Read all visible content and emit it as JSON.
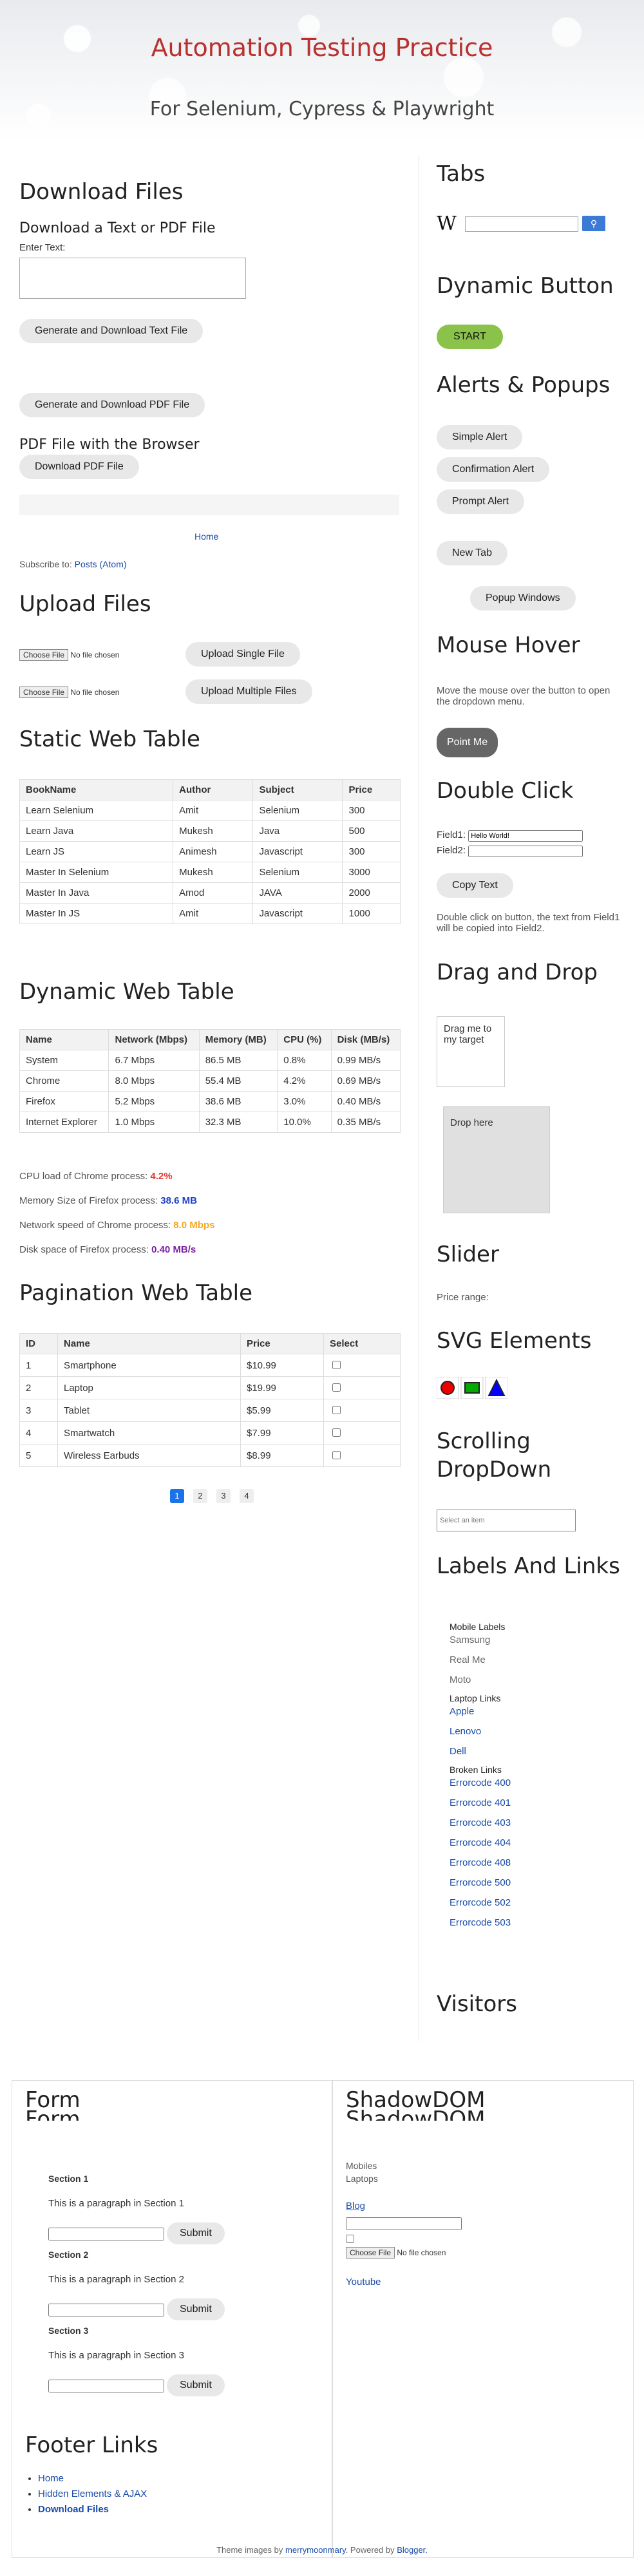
{
  "header": {
    "title": "Automation Testing Practice",
    "subtitle": "For Selenium, Cypress & Playwright"
  },
  "download": {
    "heading": "Download Files",
    "subheading": "Download a Text or PDF File",
    "enter_text_label": "Enter Text:",
    "text_btn": "Generate and Download Text File",
    "pdf_btn": "Generate and Download PDF File",
    "browser_heading": "PDF File with the Browser",
    "pdf_link_btn": "Download PDF File",
    "home_link": "Home",
    "subscribe_text": "Subscribe to:",
    "subscribe_link": "Posts (Atom)"
  },
  "upload": {
    "heading": "Upload Files",
    "choose_label": "Choose File",
    "no_file": "No file chosen",
    "single_btn": "Upload Single File",
    "multiple_btn": "Upload Multiple Files"
  },
  "static_table": {
    "heading": "Static Web Table",
    "headers": [
      "BookName",
      "Author",
      "Subject",
      "Price"
    ],
    "rows": [
      [
        "Learn Selenium",
        "Amit",
        "Selenium",
        "300"
      ],
      [
        "Learn Java",
        "Mukesh",
        "Java",
        "500"
      ],
      [
        "Learn JS",
        "Animesh",
        "Javascript",
        "300"
      ],
      [
        "Master In Selenium",
        "Mukesh",
        "Selenium",
        "3000"
      ],
      [
        "Master In Java",
        "Amod",
        "JAVA",
        "2000"
      ],
      [
        "Master In JS",
        "Amit",
        "Javascript",
        "1000"
      ]
    ]
  },
  "dynamic_table": {
    "heading": "Dynamic Web Table",
    "headers": [
      "Name",
      "Network (Mbps)",
      "Memory (MB)",
      "CPU (%)",
      "Disk (MB/s)"
    ],
    "rows": [
      [
        "System",
        "6.7 Mbps",
        "86.5 MB",
        "0.8%",
        "0.99 MB/s"
      ],
      [
        "Chrome",
        "8.0 Mbps",
        "55.4 MB",
        "4.2%",
        "0.69 MB/s"
      ],
      [
        "Firefox",
        "5.2 Mbps",
        "38.6 MB",
        "3.0%",
        "0.40 MB/s"
      ],
      [
        "Internet Explorer",
        "1.0 Mbps",
        "32.3 MB",
        "10.0%",
        "0.35 MB/s"
      ]
    ],
    "stats": [
      {
        "label": "CPU load of Chrome process:",
        "value": "4.2%",
        "color": "#e53935"
      },
      {
        "label": "Memory Size of Firefox process:",
        "value": "38.6 MB",
        "color": "#1e3fcc"
      },
      {
        "label": "Network speed of Chrome process:",
        "value": "8.0 Mbps",
        "color": "#f5a623"
      },
      {
        "label": "Disk space of Firefox process:",
        "value": "0.40 MB/s",
        "color": "#7b1fa2"
      }
    ]
  },
  "pagination_table": {
    "heading": "Pagination Web Table",
    "headers": [
      "ID",
      "Name",
      "Price",
      "Select"
    ],
    "rows": [
      [
        "1",
        "Smartphone",
        "$10.99"
      ],
      [
        "2",
        "Laptop",
        "$19.99"
      ],
      [
        "3",
        "Tablet",
        "$5.99"
      ],
      [
        "4",
        "Smartwatch",
        "$7.99"
      ],
      [
        "5",
        "Wireless Earbuds",
        "$8.99"
      ]
    ],
    "pages": [
      "1",
      "2",
      "3",
      "4"
    ]
  },
  "sidebar": {
    "tabs_heading": "Tabs",
    "wiki_letter": "W",
    "dynamic_heading": "Dynamic Button",
    "start_btn": "START",
    "alerts_heading": "Alerts & Popups",
    "simple_alert": "Simple Alert",
    "confirm_alert": "Confirmation Alert",
    "prompt_alert": "Prompt Alert",
    "new_tab": "New Tab",
    "popup_windows": "Popup Windows",
    "hover_heading": "Mouse Hover",
    "hover_text": "Move the mouse over the button to open the dropdown menu.",
    "point_me": "Point Me",
    "dblclick_heading": "Double Click",
    "field1_label": "Field1:",
    "field1_value": "Hello World!",
    "field2_label": "Field2:",
    "copy_btn": "Copy Text",
    "dblclick_text": "Double click on button, the text from Field1 will be copied into Field2.",
    "drag_heading": "Drag and Drop",
    "drag_text": "Drag me to my target",
    "drop_text": "Drop here",
    "slider_heading": "Slider",
    "price_range": "Price range:",
    "svg_heading": "SVG Elements",
    "scroll_heading": "Scrolling DropDown",
    "select_placeholder": "Select an item",
    "labels_heading": "Labels And Links",
    "mobile_labels": "Mobile Labels",
    "mobiles": [
      "Samsung",
      "Real Me",
      "Moto"
    ],
    "laptop_links": "Laptop Links",
    "laptops": [
      "Apple",
      "Lenovo",
      "Dell"
    ],
    "broken_links": "Broken Links",
    "errors": [
      "Errorcode 400",
      "Errorcode 401",
      "Errorcode 403",
      "Errorcode 404",
      "Errorcode 408",
      "Errorcode 500",
      "Errorcode 502",
      "Errorcode 503"
    ],
    "visitors_heading": "Visitors"
  },
  "form": {
    "heading": "Form",
    "sections": [
      {
        "title": "Section 1",
        "text": "This is a paragraph in Section 1"
      },
      {
        "title": "Section 2",
        "text": "This is a paragraph in Section 2"
      },
      {
        "title": "Section 3",
        "text": "This is a paragraph in Section 3"
      }
    ],
    "submit": "Submit",
    "footer_heading": "Footer Links",
    "footer_links": [
      "Home",
      "Hidden Elements & AJAX",
      "Download Files"
    ]
  },
  "shadow": {
    "heading": "ShadowDOM",
    "mobiles": "Mobiles",
    "laptops": "Laptops",
    "blog": "Blog",
    "youtube": "Youtube",
    "choose_label": "Choose File",
    "no_file": "No file chosen"
  },
  "footer": {
    "text": "Theme images by",
    "link": "merrymoonmary",
    "powered": ". Powered by",
    "blogger": "Blogger."
  }
}
